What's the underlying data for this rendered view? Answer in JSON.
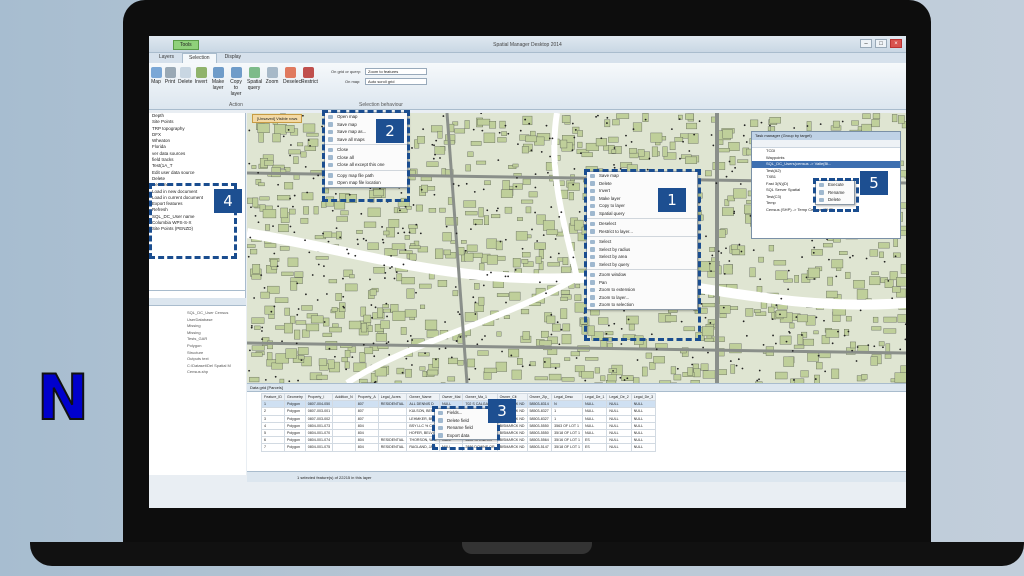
{
  "app": {
    "title": "Spatial Manager Desktop 2014",
    "tools_tab": "Tools"
  },
  "tabs": [
    "Layers",
    "Selection",
    "Display"
  ],
  "ribbon": {
    "buttons": [
      "Map",
      "Print",
      "Delete",
      "Invert",
      "Make layer",
      "Copy to layer",
      "Spatial query",
      "Zoom",
      "Deselect",
      "Restrict"
    ],
    "on_grid_label": "On grid or query:",
    "on_grid_value": "Zoom to features",
    "on_map_label": "On map:",
    "on_map_value": "Auto scroll grid",
    "group_action": "Action",
    "group_sel": "Selection behaviour"
  },
  "left_panel": {
    "items": [
      "Depth",
      "Site Points",
      "TRP topography",
      "DFX",
      "Wheaton",
      "Florida",
      "ver data sources",
      "field tracks",
      "Test(1A_T",
      "Edit user data source",
      "Delete",
      "Rename",
      "Load in new document",
      "Load in current document",
      "Export features",
      "Refresh",
      "SQL_DC_User name",
      "Columbia WPS-S-X",
      "Site Points (PENZD)"
    ],
    "props": [
      {
        "k": "",
        "v": "SQL_DC_User Census"
      },
      {
        "k": "",
        "v": "UserDatabase"
      },
      {
        "k": "",
        "v": "Missing"
      },
      {
        "k": "",
        "v": "Missing"
      },
      {
        "k": "",
        "v": "Tests_GAR"
      },
      {
        "k": "",
        "v": "Polygon"
      },
      {
        "k": "",
        "v": "Structure"
      },
      {
        "k": "",
        "v": "Outputs text"
      },
      {
        "k": "",
        "v": "C:\\Dataset\\Del Spatial M"
      },
      {
        "k": "",
        "v": "Census.shp"
      }
    ]
  },
  "menu1": {
    "items": [
      "Save map",
      "Delete",
      "Invert",
      "Make layer",
      "Copy to layer",
      "Spatial query",
      "Deselect",
      "Restrict to layer...",
      "Select",
      "Select by radius",
      "Select by area",
      "Select by query",
      "Zoom window",
      "Pan",
      "Zoom to extension",
      "Zoom to layer...",
      "Zoom to selection"
    ]
  },
  "menu2": {
    "items": [
      "Open map",
      "Save map",
      "Save map as...",
      "Save all maps",
      "Close",
      "Close all",
      "Close all except this one",
      "Copy map file path",
      "Open map file location"
    ]
  },
  "menu3": {
    "items": [
      "Fields...",
      "Delete field",
      "Rename field",
      "Export data"
    ]
  },
  "menu5": {
    "items": [
      "Execute",
      "Rename",
      "Delete"
    ]
  },
  "map_tab": "[Unsaved] Visible rows",
  "task_manager": {
    "title": "Task manager (Group by target)",
    "items": [
      "TCDI",
      "Waypoints",
      "SQL_DC_Users(census -> Valle(Bi...",
      "Test(A2)",
      "TXB1",
      "Fast 3(N)(D)",
      "SQL Server Spatial",
      "Test(C3)",
      "Temp",
      "Census (SHP) -> Temp Census (SHP)"
    ]
  },
  "grid": {
    "title": "Data grid [Parcels]",
    "columns": [
      "Feature_ID",
      "Geometry",
      "Property_I",
      "Addition_N",
      "Property_A",
      "Legal_Acres",
      "Owner_Name",
      "Owner_Mai",
      "Owner_Ma_1",
      "Owner_Cit",
      "Owner_Zip_",
      "Legal_Desc",
      "Legal_De_1",
      "Legal_De_2",
      "Legal_De_3"
    ],
    "rows": [
      [
        "1",
        "Polygon",
        "0807-004-050",
        "",
        "807",
        "RESIDENTIAL",
        "ALL DENNIS D",
        "NULL",
        "702 S CALGARY",
        "BISMARCK ND",
        "58503-8314",
        "N",
        "NULL",
        "NULL",
        "NULL"
      ],
      [
        "2",
        "Polygon",
        "0807-003-001",
        "",
        "807",
        "",
        "KULSON, BEN",
        "NULL",
        "716 S CALGARY",
        "BISMARCK ND",
        "58503-8327",
        "1",
        "NULL",
        "NULL",
        "NULL"
      ],
      [
        "3",
        "Polygon",
        "0807-003-002",
        "",
        "807",
        "",
        "LEHMKER, BRE",
        "NULL",
        "722 S CALGARY",
        "BISMARCK ND",
        "58503-8327",
        "1",
        "NULL",
        "NULL",
        "NULL"
      ],
      [
        "4",
        "Polygon",
        "0804-001-073",
        "",
        "804",
        "",
        "BSY LLC % COP",
        "NULL",
        "3512 VIEWPOIN",
        "BISMARCK ND",
        "58503-5550",
        "3563 OF LOT 1",
        "NULL",
        "NULL",
        "NULL"
      ],
      [
        "5",
        "Polygon",
        "0804-001-070",
        "",
        "804",
        "",
        "HOFER, BELVI",
        "NULL",
        "3516 VIEWPOIN",
        "BISMARCK ND",
        "58503-5550",
        "35/18 OF LOT 1",
        "NULL",
        "NULL",
        "NULL"
      ],
      [
        "6",
        "Polygon",
        "0804-001-074",
        "",
        "804",
        "RESIDENTIAL",
        "THORSON, WAL",
        "NULL",
        "3502 STONEHO",
        "BISMARCK ND",
        "58503-5564",
        "35/16 OF LOT 1",
        "ES",
        "NULL",
        "NULL"
      ],
      [
        "7",
        "Polygon",
        "0804-001-075",
        "",
        "804",
        "RESIDENTIAL",
        "RAGLAND, JAN",
        "NULL",
        "2886 DOWNS OR",
        "BISMARCK ND",
        "58503-5147",
        "35/18 OF LOT 1",
        "ES",
        "NULL",
        "NULL"
      ]
    ]
  },
  "status": "1 selected feature(s) of 22215 in this layer",
  "callouts": [
    "1",
    "2",
    "3",
    "4",
    "5"
  ],
  "logo": "N",
  "colors": {
    "callout": "#1d4f91",
    "map_bg": "#dfe5d2",
    "parcel": "#bfcf9a",
    "water": "#ffffff",
    "road": "#8a8f8a"
  }
}
